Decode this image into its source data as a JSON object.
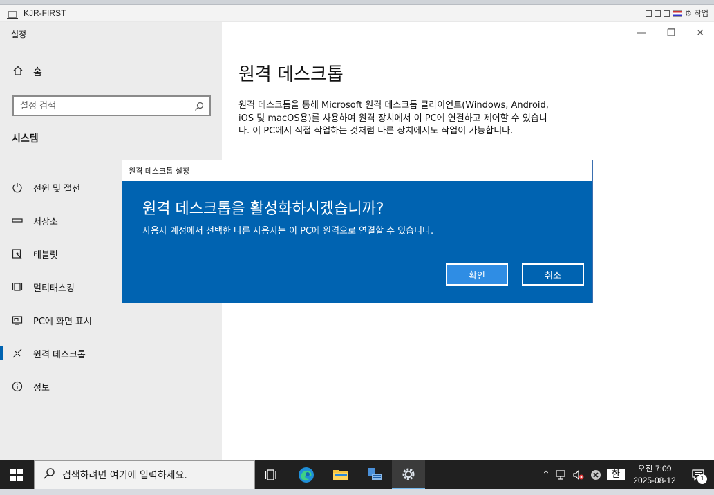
{
  "host": {
    "window_title": "KJR-FIRST",
    "action_label": "작업"
  },
  "settings": {
    "app_label": "설정",
    "home_label": "홈",
    "search_placeholder": "설정 검색",
    "section_title": "시스템",
    "nav_items": [
      {
        "label": "전원 및 절전",
        "icon": "power-icon"
      },
      {
        "label": "저장소",
        "icon": "storage-icon"
      },
      {
        "label": "태블릿",
        "icon": "tablet-icon"
      },
      {
        "label": "멀티태스킹",
        "icon": "multitasking-icon"
      },
      {
        "label": "PC에 화면 표시",
        "icon": "project-icon"
      },
      {
        "label": "원격 데스크톱",
        "icon": "remote-desktop-icon",
        "selected": true
      },
      {
        "label": "정보",
        "icon": "info-icon"
      }
    ],
    "page_title": "원격 데스크톱",
    "page_description": "원격 데스크톱을 통해 Microsoft 원격 데스크톱 클라이언트(Windows, Android, iOS 및 macOS용)를 사용하여 원격 장치에서 이 PC에 연결하고 제어할 수 있습니다. 이 PC에서 직접 작업하는 것처럼 다른 장치에서도 작업이 가능합니다."
  },
  "dialog": {
    "title": "원격 데스크톱 설정",
    "heading": "원격 데스크톱을 활성화하시겠습니까?",
    "message": "사용자 계정에서 선택한 다른 사용자는 이 PC에 원격으로 연결할 수 있습니다.",
    "confirm_label": "확인",
    "cancel_label": "취소"
  },
  "taskbar": {
    "search_placeholder": "검색하려면 여기에 입력하세요.",
    "clock_time": "오전 7:09",
    "clock_date": "2025-08-12",
    "ime_label": "한",
    "notification_count": "1"
  },
  "colors": {
    "accent": "#0063b1",
    "dialog_bg": "#0063b1",
    "taskbar_bg": "#202020",
    "sidebar_bg": "#ececec"
  }
}
